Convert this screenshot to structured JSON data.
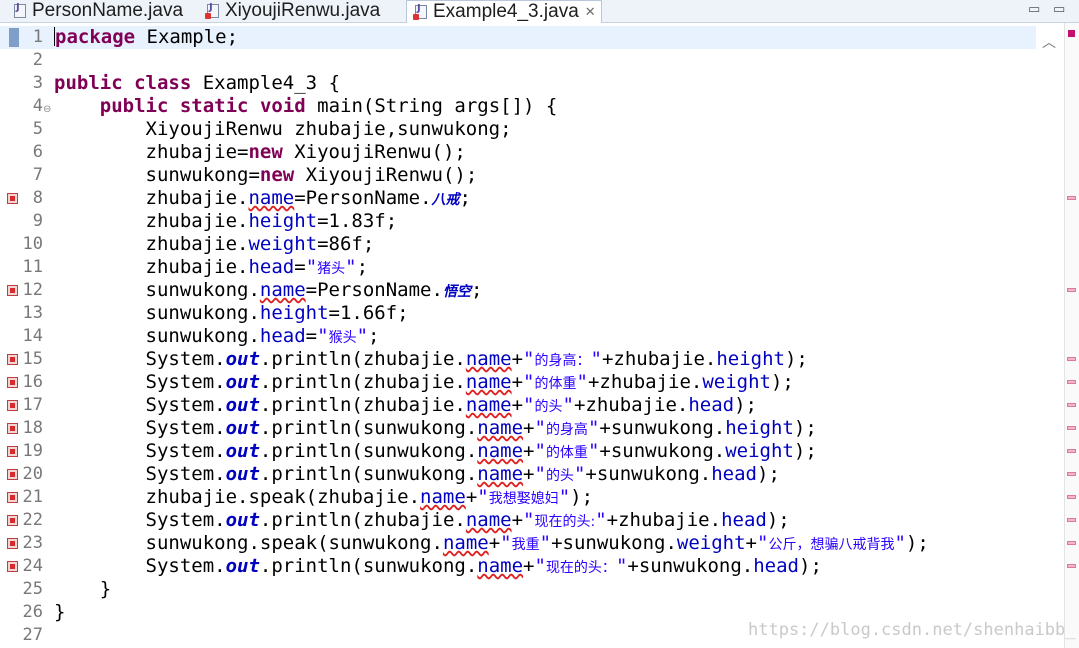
{
  "tabs": [
    {
      "label": "PersonName.java",
      "error": false,
      "active": false
    },
    {
      "label": "XiyoujiRenwu.java",
      "error": true,
      "active": false
    },
    {
      "label": "Example4_3.java",
      "error": true,
      "active": true
    }
  ],
  "window_controls": {
    "minimize": "▭",
    "maximize": "▭"
  },
  "tab_close_glyph": "✕",
  "watermark": "https://blog.csdn.net/shenhaibb_",
  "lines": [
    {
      "n": "1",
      "cur": true,
      "err": false,
      "fold": false,
      "tokens": [
        [
          "kw",
          "package"
        ],
        [
          "p",
          " Example;"
        ]
      ]
    },
    {
      "n": "2",
      "cur": false,
      "err": false,
      "fold": false,
      "tokens": []
    },
    {
      "n": "3",
      "cur": false,
      "err": false,
      "fold": false,
      "tokens": [
        [
          "kw",
          "public"
        ],
        [
          "p",
          " "
        ],
        [
          "kw",
          "class"
        ],
        [
          "p",
          " Example4_3 {"
        ]
      ]
    },
    {
      "n": "4",
      "cur": false,
      "err": false,
      "fold": true,
      "tokens": [
        [
          "p",
          "    "
        ],
        [
          "kw",
          "public"
        ],
        [
          "p",
          " "
        ],
        [
          "kw",
          "static"
        ],
        [
          "p",
          " "
        ],
        [
          "kw",
          "void"
        ],
        [
          "p",
          " main(String args[]) {"
        ]
      ]
    },
    {
      "n": "5",
      "cur": false,
      "err": false,
      "fold": false,
      "tokens": [
        [
          "p",
          "        XiyoujiRenwu "
        ],
        [
          "p",
          "zhubajie,sunwukong;"
        ]
      ]
    },
    {
      "n": "6",
      "cur": false,
      "err": false,
      "fold": false,
      "tokens": [
        [
          "p",
          "        zhubajie="
        ],
        [
          "kw",
          "new"
        ],
        [
          "p",
          " XiyoujiRenwu();"
        ]
      ]
    },
    {
      "n": "7",
      "cur": false,
      "err": false,
      "fold": false,
      "tokens": [
        [
          "p",
          "        sunwukong="
        ],
        [
          "kw",
          "new"
        ],
        [
          "p",
          " XiyoujiRenwu();"
        ]
      ]
    },
    {
      "n": "8",
      "cur": false,
      "err": true,
      "fold": false,
      "tokens": [
        [
          "p",
          "        zhubajie."
        ],
        [
          "fld_e",
          "name"
        ],
        [
          "p",
          "=PersonName."
        ],
        [
          "cjkb",
          "八戒"
        ],
        [
          "p",
          ";"
        ]
      ]
    },
    {
      "n": "9",
      "cur": false,
      "err": false,
      "fold": false,
      "tokens": [
        [
          "p",
          "        zhubajie."
        ],
        [
          "fld",
          "height"
        ],
        [
          "p",
          "=1.83f;"
        ]
      ]
    },
    {
      "n": "10",
      "cur": false,
      "err": false,
      "fold": false,
      "tokens": [
        [
          "p",
          "        zhubajie."
        ],
        [
          "fld",
          "weight"
        ],
        [
          "p",
          "=86f;"
        ]
      ]
    },
    {
      "n": "11",
      "cur": false,
      "err": false,
      "fold": false,
      "tokens": [
        [
          "p",
          "        zhubajie."
        ],
        [
          "fld",
          "head"
        ],
        [
          "p",
          "="
        ],
        [
          "str",
          "\""
        ],
        [
          "strc",
          "猪头"
        ],
        [
          "str",
          "\""
        ],
        [
          "p",
          ";"
        ]
      ]
    },
    {
      "n": "12",
      "cur": false,
      "err": true,
      "fold": false,
      "tokens": [
        [
          "p",
          "        sunwukong."
        ],
        [
          "fld_e",
          "name"
        ],
        [
          "p",
          "=PersonName."
        ],
        [
          "cjkb",
          "悟空"
        ],
        [
          "p",
          ";"
        ]
      ]
    },
    {
      "n": "13",
      "cur": false,
      "err": false,
      "fold": false,
      "tokens": [
        [
          "p",
          "        sunwukong."
        ],
        [
          "fld",
          "height"
        ],
        [
          "p",
          "=1.66f;"
        ]
      ]
    },
    {
      "n": "14",
      "cur": false,
      "err": false,
      "fold": false,
      "tokens": [
        [
          "p",
          "        sunwukong."
        ],
        [
          "fld",
          "head"
        ],
        [
          "p",
          "="
        ],
        [
          "str",
          "\""
        ],
        [
          "strc",
          "猴头"
        ],
        [
          "str",
          "\""
        ],
        [
          "p",
          ";"
        ]
      ]
    },
    {
      "n": "15",
      "cur": false,
      "err": true,
      "fold": false,
      "tokens": [
        [
          "p",
          "        System."
        ],
        [
          "sfld",
          "out"
        ],
        [
          "p",
          ".println(zhubajie."
        ],
        [
          "fld_e",
          "name"
        ],
        [
          "p",
          "+"
        ],
        [
          "str",
          "\""
        ],
        [
          "strc",
          "的身高："
        ],
        [
          "str",
          "\""
        ],
        [
          "p",
          "+zhubajie."
        ],
        [
          "fld",
          "height"
        ],
        [
          "p",
          ");"
        ]
      ]
    },
    {
      "n": "16",
      "cur": false,
      "err": true,
      "fold": false,
      "tokens": [
        [
          "p",
          "        System."
        ],
        [
          "sfld",
          "out"
        ],
        [
          "p",
          ".println(zhubajie."
        ],
        [
          "fld_e",
          "name"
        ],
        [
          "p",
          "+"
        ],
        [
          "str",
          "\""
        ],
        [
          "strc",
          "的体重"
        ],
        [
          "str",
          "\""
        ],
        [
          "p",
          "+zhubajie."
        ],
        [
          "fld",
          "weight"
        ],
        [
          "p",
          ");"
        ]
      ]
    },
    {
      "n": "17",
      "cur": false,
      "err": true,
      "fold": false,
      "tokens": [
        [
          "p",
          "        System."
        ],
        [
          "sfld",
          "out"
        ],
        [
          "p",
          ".println(zhubajie."
        ],
        [
          "fld_e",
          "name"
        ],
        [
          "p",
          "+"
        ],
        [
          "str",
          "\""
        ],
        [
          "strc",
          "的头"
        ],
        [
          "str",
          "\""
        ],
        [
          "p",
          "+zhubajie."
        ],
        [
          "fld",
          "head"
        ],
        [
          "p",
          ");"
        ]
      ]
    },
    {
      "n": "18",
      "cur": false,
      "err": true,
      "fold": false,
      "tokens": [
        [
          "p",
          "        System."
        ],
        [
          "sfld",
          "out"
        ],
        [
          "p",
          ".println(sunwukong."
        ],
        [
          "fld_e",
          "name"
        ],
        [
          "p",
          "+"
        ],
        [
          "str",
          "\""
        ],
        [
          "strc",
          "的身高"
        ],
        [
          "str",
          "\""
        ],
        [
          "p",
          "+sunwukong."
        ],
        [
          "fld",
          "height"
        ],
        [
          "p",
          ");"
        ]
      ]
    },
    {
      "n": "19",
      "cur": false,
      "err": true,
      "fold": false,
      "tokens": [
        [
          "p",
          "        System."
        ],
        [
          "sfld",
          "out"
        ],
        [
          "p",
          ".println(sunwukong."
        ],
        [
          "fld_e",
          "name"
        ],
        [
          "p",
          "+"
        ],
        [
          "str",
          "\""
        ],
        [
          "strc",
          "的体重"
        ],
        [
          "str",
          "\""
        ],
        [
          "p",
          "+sunwukong."
        ],
        [
          "fld",
          "weight"
        ],
        [
          "p",
          ");"
        ]
      ]
    },
    {
      "n": "20",
      "cur": false,
      "err": true,
      "fold": false,
      "tokens": [
        [
          "p",
          "        System."
        ],
        [
          "sfld",
          "out"
        ],
        [
          "p",
          ".println(sunwukong."
        ],
        [
          "fld_e",
          "name"
        ],
        [
          "p",
          "+"
        ],
        [
          "str",
          "\""
        ],
        [
          "strc",
          "的头"
        ],
        [
          "str",
          "\""
        ],
        [
          "p",
          "+sunwukong."
        ],
        [
          "fld",
          "head"
        ],
        [
          "p",
          ");"
        ]
      ]
    },
    {
      "n": "21",
      "cur": false,
      "err": true,
      "fold": false,
      "tokens": [
        [
          "p",
          "        zhubajie.speak(zhubajie."
        ],
        [
          "fld_e",
          "name"
        ],
        [
          "p",
          "+"
        ],
        [
          "str",
          "\""
        ],
        [
          "strc",
          "我想娶媳妇"
        ],
        [
          "str",
          "\""
        ],
        [
          "p",
          ");"
        ]
      ]
    },
    {
      "n": "22",
      "cur": false,
      "err": true,
      "fold": false,
      "tokens": [
        [
          "p",
          "        System."
        ],
        [
          "sfld",
          "out"
        ],
        [
          "p",
          ".println(zhubajie."
        ],
        [
          "fld_e",
          "name"
        ],
        [
          "p",
          "+"
        ],
        [
          "str",
          "\""
        ],
        [
          "strc",
          "现在的头:"
        ],
        [
          "str",
          "\""
        ],
        [
          "p",
          "+zhubajie."
        ],
        [
          "fld",
          "head"
        ],
        [
          "p",
          ");"
        ]
      ]
    },
    {
      "n": "23",
      "cur": false,
      "err": true,
      "fold": false,
      "tokens": [
        [
          "p",
          "        sunwukong.speak(sunwukong."
        ],
        [
          "fld_e",
          "name"
        ],
        [
          "p",
          "+"
        ],
        [
          "str",
          "\""
        ],
        [
          "strc",
          "我重"
        ],
        [
          "str",
          "\""
        ],
        [
          "p",
          "+sunwukong."
        ],
        [
          "fld",
          "weight"
        ],
        [
          "p",
          "+"
        ],
        [
          "str",
          "\""
        ],
        [
          "strc",
          "公斤，想骗八戒背我"
        ],
        [
          "str",
          "\""
        ],
        [
          "p",
          ");"
        ]
      ]
    },
    {
      "n": "24",
      "cur": false,
      "err": true,
      "fold": false,
      "tokens": [
        [
          "p",
          "        System."
        ],
        [
          "sfld",
          "out"
        ],
        [
          "p",
          ".println(sunwukong."
        ],
        [
          "fld_e",
          "name"
        ],
        [
          "p",
          "+"
        ],
        [
          "str",
          "\""
        ],
        [
          "strc",
          "现在的头："
        ],
        [
          "str",
          "\""
        ],
        [
          "p",
          "+sunwukong."
        ],
        [
          "fld",
          "head"
        ],
        [
          "p",
          ");"
        ]
      ]
    },
    {
      "n": "25",
      "cur": false,
      "err": false,
      "fold": false,
      "tokens": [
        [
          "p",
          "    }"
        ]
      ]
    },
    {
      "n": "26",
      "cur": false,
      "err": false,
      "fold": false,
      "tokens": [
        [
          "p",
          "}"
        ]
      ]
    },
    {
      "n": "27",
      "cur": false,
      "err": false,
      "fold": false,
      "tokens": []
    }
  ],
  "colors": {
    "keyword": "#7f0055",
    "field": "#0000c0",
    "string": "#2a00ff",
    "error": "#e02020",
    "line_number": "#787878",
    "current_line": "#e8f2fe"
  }
}
